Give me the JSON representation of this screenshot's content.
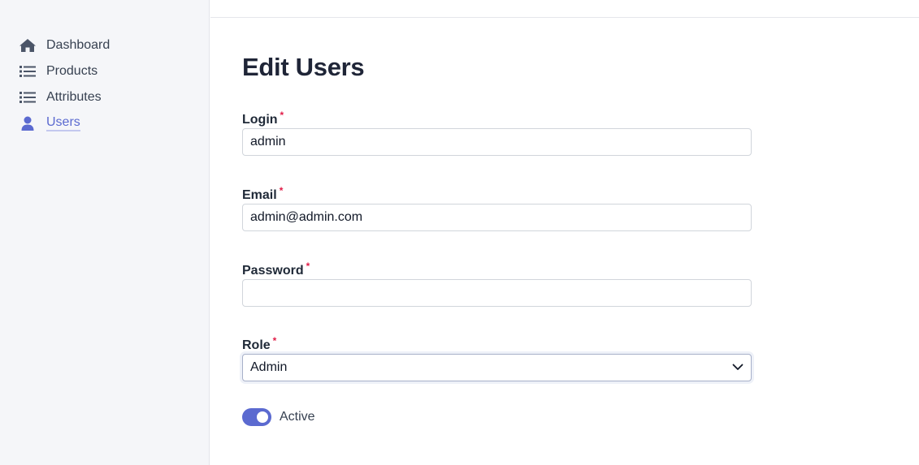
{
  "sidebar": {
    "items": [
      {
        "label": "Dashboard",
        "icon": "home-icon"
      },
      {
        "label": "Products",
        "icon": "list-icon"
      },
      {
        "label": "Attributes",
        "icon": "list-icon"
      },
      {
        "label": "Users",
        "icon": "user-icon",
        "active": true
      }
    ]
  },
  "page": {
    "title": "Edit Users"
  },
  "form": {
    "login": {
      "label": "Login",
      "required_mark": "*",
      "value": "admin"
    },
    "email": {
      "label": "Email",
      "required_mark": "*",
      "value": "admin@admin.com"
    },
    "password": {
      "label": "Password",
      "required_mark": "*",
      "value": ""
    },
    "role": {
      "label": "Role",
      "required_mark": "*",
      "value": "Admin"
    },
    "active": {
      "label": "Active",
      "checked": true
    }
  },
  "colors": {
    "accent": "#5b6ad0",
    "sidebar_bg": "#f5f6f9",
    "required": "#e11d48",
    "icon": "#4b5568"
  }
}
